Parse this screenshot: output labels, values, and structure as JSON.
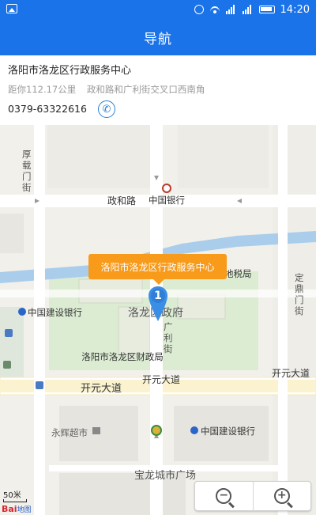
{
  "status_bar": {
    "time": "14:20"
  },
  "nav": {
    "title": "导航"
  },
  "place": {
    "name": "洛阳市洛龙区行政服务中心",
    "distance": "距你112.17公里",
    "address": "政和路和广利街交叉口西南角",
    "phone": "0379-63322616"
  },
  "map": {
    "labels": {
      "houzai": "厚载门街",
      "zhenghe_road": "政和路",
      "bank_china": "中国银行",
      "tax_bureau": "地税局",
      "dingding": "定鼎门街",
      "ccb_1": "中国建设银行",
      "gov": "洛龙区政府",
      "guangli": "广利街",
      "finance_bureau": "洛阳市洛龙区财政局",
      "kaiyuan_1": "开元大道",
      "kaiyuan_2": "开元大道",
      "kaiyuan_3": "开元大道",
      "yonghui": "永辉超市",
      "ccb_2": "中国建设银行",
      "baocheng": "宝龙城市广场"
    },
    "callout": "洛阳市洛龙区行政服务中心",
    "pin_number": "1",
    "scale": "50米",
    "logo_main": "Bai",
    "logo_sub": "地图"
  },
  "zoom": {
    "out": "−",
    "in": "+"
  },
  "colors": {
    "accent": "#1a73e8",
    "callout": "#f89a1a",
    "river": "#a9cdea",
    "park": "#dcecd3"
  }
}
